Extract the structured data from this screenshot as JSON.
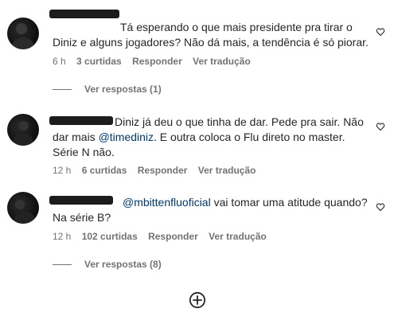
{
  "comments": [
    {
      "text": "Tá esperando o que mais presidente pra tirar o Diniz e alguns jogadores? Não dá mais, a tendência é só piorar.",
      "time": "6 h",
      "likes": "3 curtidas",
      "reply": "Responder",
      "translate": "Ver tradução",
      "view_replies": "Ver respostas (1)"
    },
    {
      "text_before": "Diniz já deu o que tinha de dar. Pede pra sair. Não dar mais ",
      "mention": "@timediniz",
      "text_after": ". E outra coloca o Flu direto no master. Série N não.",
      "time": "12 h",
      "likes": "6 curtidas",
      "reply": "Responder",
      "translate": "Ver tradução"
    },
    {
      "mention": "@mbittenfluoficial",
      "text_after": " vai tomar uma atitude quando? Na série B?",
      "time": "12 h",
      "likes": "102 curtidas",
      "reply": "Responder",
      "translate": "Ver tradução",
      "view_replies": "Ver respostas (8)"
    }
  ],
  "icons": {
    "like": "heart-outline-icon",
    "load_more": "plus-circle-icon"
  }
}
